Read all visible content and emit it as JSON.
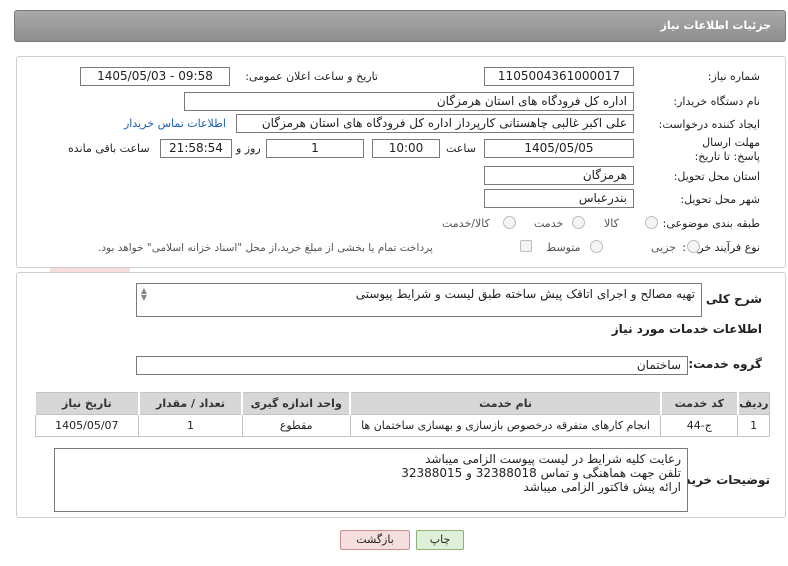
{
  "header": {
    "title": "جزئیات اطلاعات نیاز"
  },
  "fields": {
    "need_number_label": "شماره نیاز:",
    "need_number": "1105004361000017",
    "announce_label": "تاریخ و ساعت اعلان عمومی:",
    "announce_value": "1405/05/03 - 09:58",
    "buyer_org_label": "نام دستگاه خریدار:",
    "buyer_org": "اداره کل فرودگاه های استان هرمزگان",
    "creator_label": "ایجاد کننده درخواست:",
    "creator": "علی اکبر غالبی چاهستانی کارپرداز اداره کل فرودگاه های استان هرمزگان",
    "contact_link": "اطلاعات تماس خریدار",
    "deadline_label": "مهلت ارسال پاسخ: تا تاریخ:",
    "deadline_date": "1405/05/05",
    "time_label": "ساعت",
    "deadline_time": "10:00",
    "days_value": "1",
    "days_label": "روز و",
    "remaining_time": "21:58:54",
    "remaining_label": "ساعت باقی مانده",
    "province_label": "استان محل تحویل:",
    "province": "هرمزگان",
    "city_label": "شهر محل تحویل:",
    "city": "بندرعباس",
    "category_label": "طبقه بندی موضوعی:",
    "category_options": [
      "کالا",
      "خدمت",
      "کالا/خدمت"
    ],
    "process_label": "نوع فرآیند خرید :",
    "process_options": [
      "جزیی",
      "متوسط"
    ],
    "payment_note": "پرداخت تمام یا بخشی از مبلغ خرید،از محل \"اسناد خزانه اسلامی\" خواهد بود."
  },
  "description": {
    "label": "شرح کلی نیاز:",
    "text": "تهیه مصالح و اجرای اتاقک پیش ساخته طبق لیست و شرایط پیوستی"
  },
  "services": {
    "section_title": "اطلاعات خدمات مورد نیاز",
    "group_label": "گروه خدمت:",
    "group_value": "ساختمان",
    "columns": [
      "ردیف",
      "کد خدمت",
      "نام خدمت",
      "واحد اندازه گیری",
      "تعداد / مقدار",
      "تاریخ نیاز"
    ],
    "rows": [
      [
        "1",
        "ج-44",
        "انجام کارهای متفرقه درخصوص بازسازی و بهسازی ساختمان ها",
        "مقطوع",
        "1",
        "1405/05/07"
      ]
    ]
  },
  "buyer_notes": {
    "label": "توضیحات خریدار:",
    "lines": [
      "رعایت کلیه شرایط در لیست پیوست الزامی میباشد",
      "تلفن جهت هماهنگی و تماس 32388018 و 32388015",
      "ارائه پیش فاکتور الزامی میباشد"
    ]
  },
  "buttons": {
    "print": "چاپ",
    "back": "بازگشت"
  },
  "watermark": {
    "text": "AriaTender.net"
  },
  "colors": {
    "header": "#999999",
    "link": "#1a5fb4",
    "print_btn": "#dff0d8",
    "back_btn": "#f6dede"
  }
}
